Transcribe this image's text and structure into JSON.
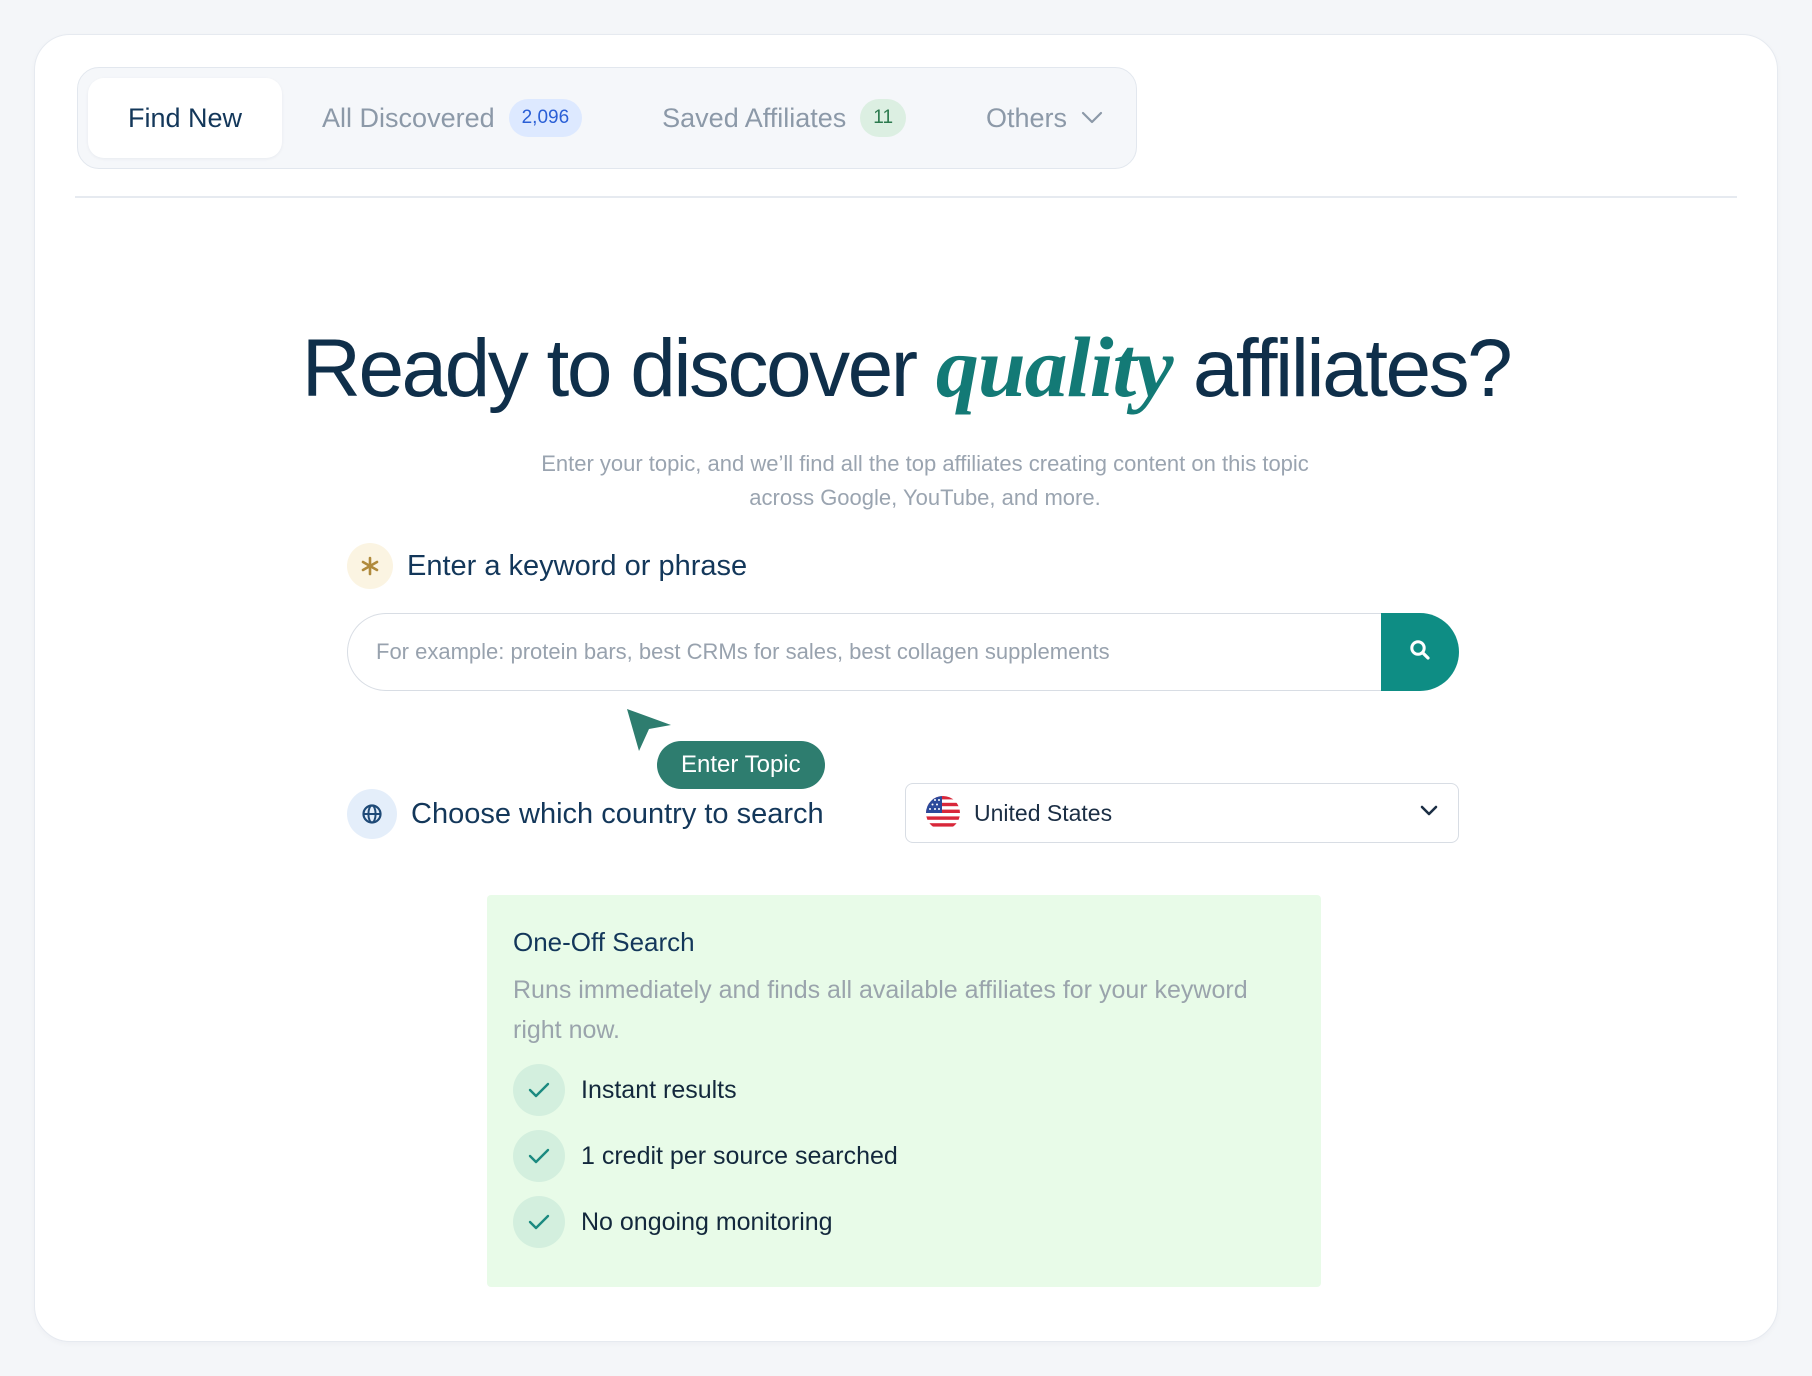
{
  "tabs": [
    {
      "label": "Find New",
      "active": true
    },
    {
      "label": "All Discovered",
      "badge": "2,096"
    },
    {
      "label": "Saved Affiliates",
      "badge": "11"
    },
    {
      "label": "Others",
      "dropdown": true
    }
  ],
  "hero": {
    "title_before": "Ready to discover ",
    "title_accent": "quality",
    "title_after": " affiliates?",
    "subtitle_line1": "Enter your topic, and we’ll find all the top affiliates creating content on this topic",
    "subtitle_line2": "across Google, YouTube, and more."
  },
  "keyword": {
    "label": "Enter a keyword or phrase",
    "icon": "asterisk-icon",
    "value": "",
    "placeholder": "For example: protein bars, best CRMs for sales, best collagen supplements"
  },
  "tooltip": {
    "label": "Enter Topic"
  },
  "country": {
    "label": "Choose which country to search",
    "icon": "globe-icon",
    "selected": "United States",
    "flag": "us-flag-icon"
  },
  "oneoff": {
    "title": "One-Off Search",
    "description": "Runs immediately and finds all available affiliates for your keyword right now.",
    "features": [
      "Instant results",
      "1 credit per source searched",
      "No ongoing monitoring"
    ]
  },
  "colors": {
    "accent": "#137a76",
    "search_button": "#0e8d84",
    "tooltip": "#2e7d6f",
    "card_bg": "#e8fbe8"
  }
}
